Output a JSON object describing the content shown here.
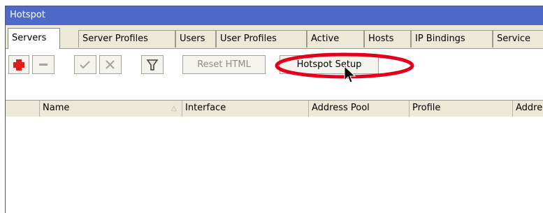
{
  "window": {
    "title": "Hotspot"
  },
  "tabs": [
    {
      "label": "Servers",
      "active": true
    },
    {
      "label": "Server Profiles",
      "active": false
    },
    {
      "label": "Users",
      "active": false
    },
    {
      "label": "User Profiles",
      "active": false
    },
    {
      "label": "Active",
      "active": false
    },
    {
      "label": "Hosts",
      "active": false
    },
    {
      "label": "IP Bindings",
      "active": false
    },
    {
      "label": "Service",
      "active": false
    }
  ],
  "toolbar": {
    "add_icon": "plus-icon",
    "remove_icon": "minus-icon",
    "enable_icon": "check-icon",
    "disable_icon": "cross-icon",
    "filter_icon": "filter-icon",
    "reset_html_label": "Reset HTML",
    "hotspot_setup_label": "Hotspot Setup"
  },
  "colors": {
    "titlebar": "#4f69c9",
    "add_icon": "#e21b1b",
    "highlight_ellipse": "#e3001b"
  },
  "table": {
    "columns": [
      "",
      "Name",
      "Interface",
      "Address Pool",
      "Profile",
      "Addre"
    ],
    "sort_indicator": "△",
    "rows": []
  }
}
